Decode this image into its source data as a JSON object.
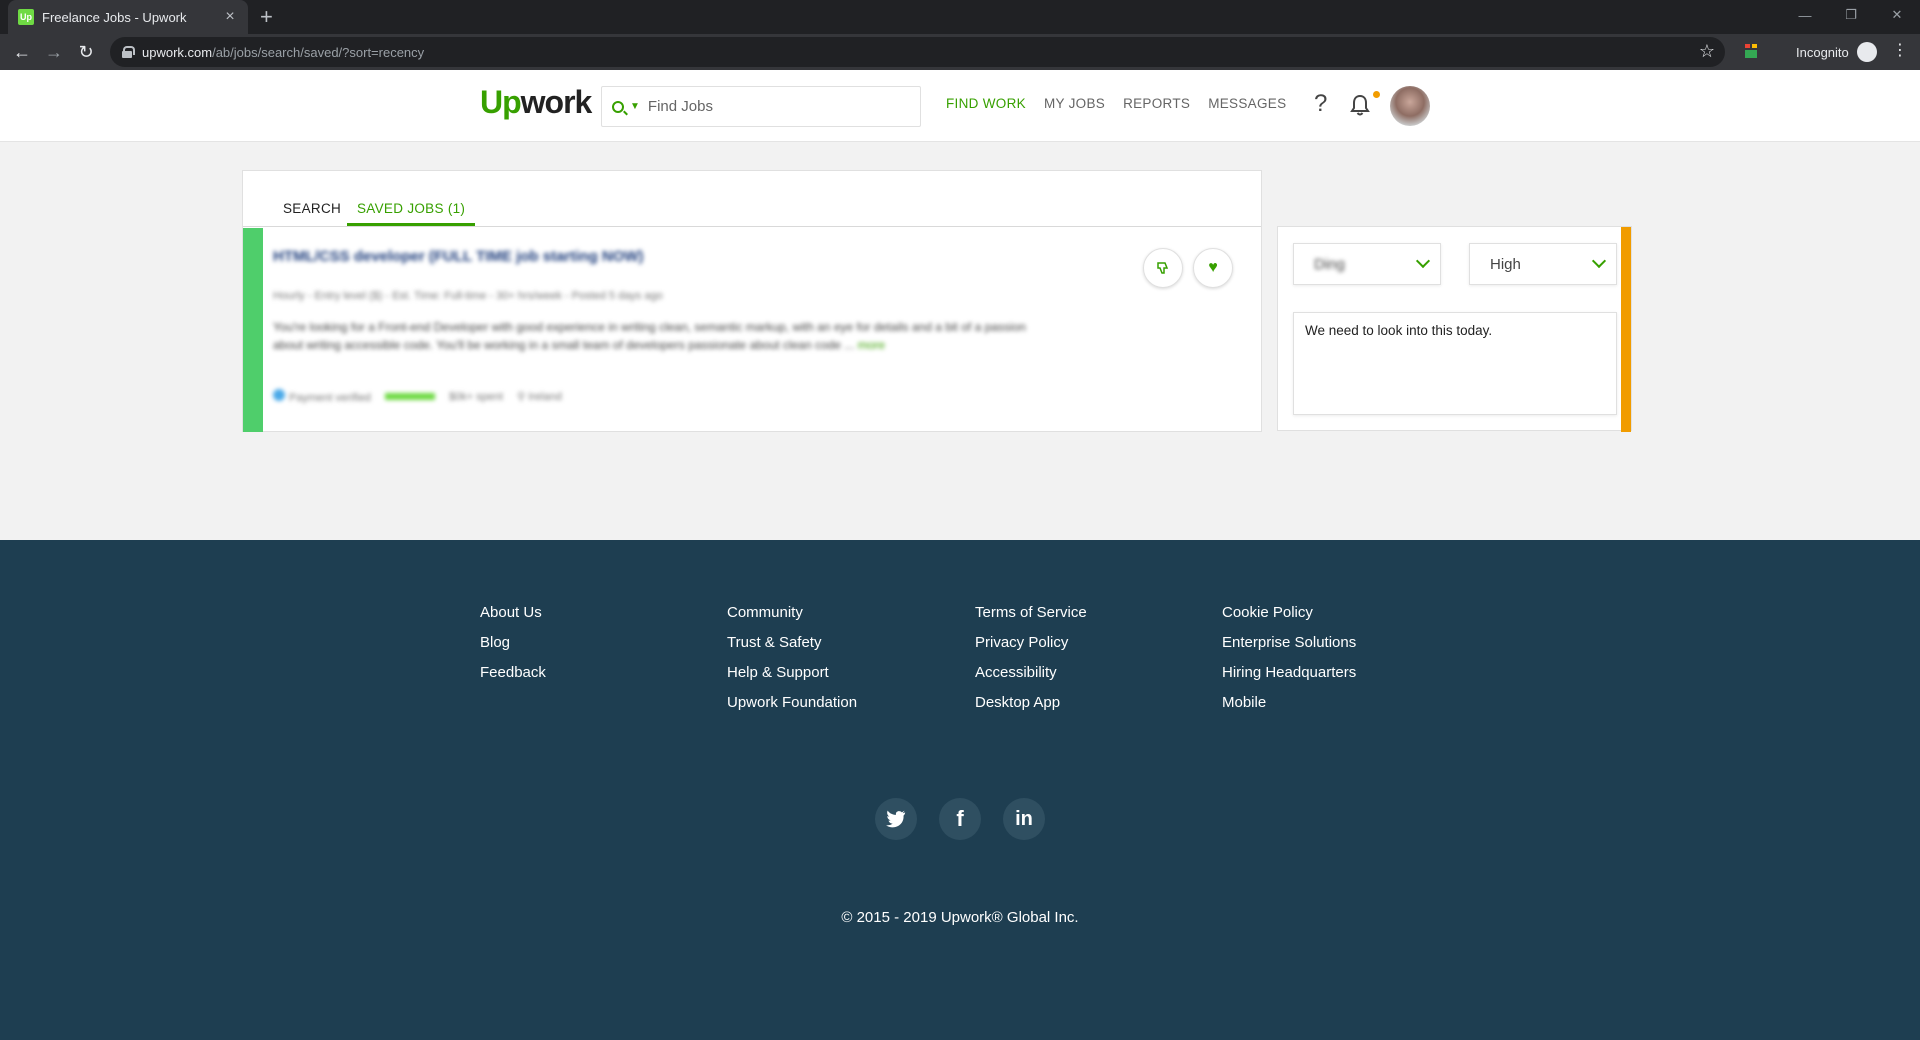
{
  "browser": {
    "tab_title": "Freelance Jobs - Upwork",
    "favicon_text": "Up",
    "url_host": "upwork.com",
    "url_path": "/ab/jobs/search/saved/?sort=recency",
    "incognito_label": "Incognito"
  },
  "header": {
    "logo_up": "Up",
    "logo_rest": "work",
    "search_placeholder": "Find Jobs",
    "nav": [
      "FIND WORK",
      "MY JOBS",
      "REPORTS",
      "MESSAGES"
    ],
    "help": "?"
  },
  "tabs": {
    "search": "SEARCH",
    "saved": "SAVED JOBS (1)"
  },
  "job": {
    "title": "HTML/CSS developer (FULL TIME job starting NOW)",
    "meta": "Hourly - Entry level ($) - Est. Time: Full-time - 30+ hrs/week - Posted 5 days ago",
    "description": "You're looking for a Front-end Developer with good experience in writing clean, semantic markup, with an eye for details and a bit of a passion about writing accessible code. You'll be working in a small team of developers passionate about clean code ...",
    "more": "more",
    "payment": "Payment verified",
    "spent": "$0k+ spent",
    "location": "Ireland"
  },
  "side_panel": {
    "status": "Ding",
    "priority": "High",
    "note": "We need to look into this today."
  },
  "footer": {
    "col1": [
      "About Us",
      "Blog",
      "Feedback"
    ],
    "col2": [
      "Community",
      "Trust & Safety",
      "Help & Support",
      "Upwork Foundation"
    ],
    "col3": [
      "Terms of Service",
      "Privacy Policy",
      "Accessibility",
      "Desktop App"
    ],
    "col4": [
      "Cookie Policy",
      "Enterprise Solutions",
      "Hiring Headquarters",
      "Mobile"
    ],
    "social": [
      "twitter-icon",
      "facebook-icon",
      "linkedin-icon"
    ],
    "copyright": "© 2015 - 2019 Upwork® Global Inc."
  },
  "colors": {
    "brand_green": "#37a000",
    "job_accent": "#4fce6b",
    "note_accent": "#f19c00",
    "footer_bg": "#1e3e51"
  }
}
